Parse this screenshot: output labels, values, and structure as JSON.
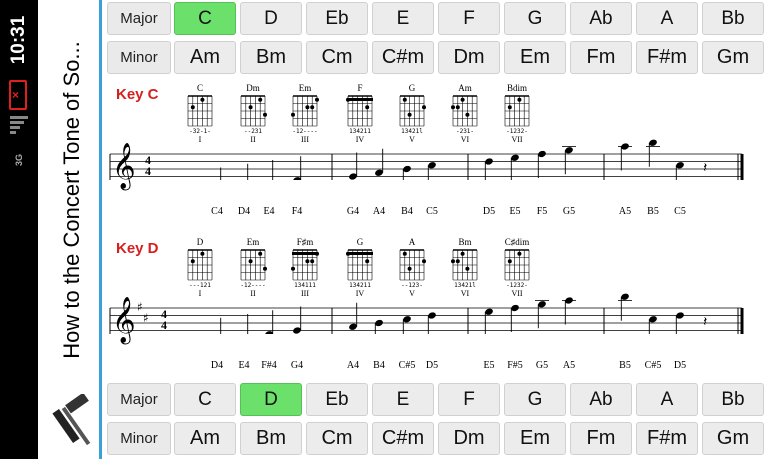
{
  "status": {
    "time": "10:31",
    "net": "3G"
  },
  "app": {
    "title": "How to the Concert Tone of So..."
  },
  "top_rows": {
    "major": {
      "label": "Major",
      "keys": [
        "C",
        "D",
        "Eb",
        "E",
        "F",
        "G",
        "Ab",
        "A",
        "Bb"
      ],
      "selected": "C"
    },
    "minor": {
      "label": "Minor",
      "keys": [
        "Am",
        "Bm",
        "Cm",
        "C#m",
        "Dm",
        "Em",
        "Fm",
        "F#m",
        "Gm"
      ]
    }
  },
  "bottom_rows": {
    "major": {
      "label": "Major",
      "keys": [
        "C",
        "D",
        "Eb",
        "E",
        "F",
        "G",
        "Ab",
        "A",
        "Bb"
      ],
      "selected": "D"
    },
    "minor": {
      "label": "Minor",
      "keys": [
        "Am",
        "Bm",
        "Cm",
        "C#m",
        "Dm",
        "Em",
        "Fm",
        "F#m",
        "Gm"
      ]
    }
  },
  "sections": [
    {
      "key_label": "Key C",
      "chords": [
        {
          "name": "C",
          "roman": "I",
          "fingering": "-32-1-"
        },
        {
          "name": "Dm",
          "roman": "II",
          "fingering": "--231"
        },
        {
          "name": "Em",
          "roman": "III",
          "fingering": "-12----"
        },
        {
          "name": "F",
          "roman": "IV",
          "fingering": "134211"
        },
        {
          "name": "G",
          "roman": "V",
          "fingering": "13421l"
        },
        {
          "name": "Am",
          "roman": "VI",
          "fingering": "-231-"
        },
        {
          "name": "Bdim",
          "roman": "VII",
          "fingering": "-1232-"
        }
      ],
      "time_signature": "4/4",
      "key_signature_sharps": 0,
      "notes": [
        "C4",
        "D4",
        "E4",
        "F4",
        "G4",
        "A4",
        "B4",
        "C5",
        "D5",
        "E5",
        "F5",
        "G5",
        "A5",
        "B5",
        "C5"
      ]
    },
    {
      "key_label": "Key D",
      "chords": [
        {
          "name": "D",
          "roman": "I",
          "fingering": "---121"
        },
        {
          "name": "Em",
          "roman": "II",
          "fingering": "-12----"
        },
        {
          "name": "F♯m",
          "roman": "III",
          "fingering": "134111"
        },
        {
          "name": "G",
          "roman": "IV",
          "fingering": "134211"
        },
        {
          "name": "A",
          "roman": "V",
          "fingering": "--123-"
        },
        {
          "name": "Bm",
          "roman": "VI",
          "fingering": "13421l"
        },
        {
          "name": "C♯dim",
          "roman": "VII",
          "fingering": "-1232-"
        }
      ],
      "time_signature": "4/4",
      "key_signature_sharps": 2,
      "notes": [
        "D4",
        "E4",
        "F#4",
        "G4",
        "A4",
        "B4",
        "C#5",
        "D5",
        "E5",
        "F#5",
        "G5",
        "A5",
        "B5",
        "C#5",
        "D5"
      ]
    }
  ]
}
